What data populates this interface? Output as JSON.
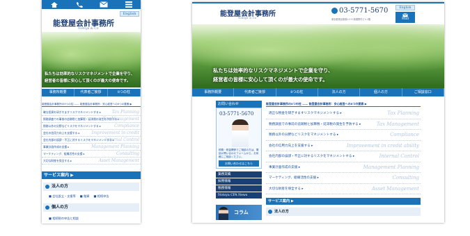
{
  "mobile": {
    "icons": [
      "home-icon",
      "phone-icon",
      "mail-icon",
      "menu-icon"
    ],
    "english_label": "English",
    "title": "能登屋会計事務所",
    "subtitle": "Notoya & Co",
    "hero_caption_1": "私たちは効率的なリスクマネジメントで企業を守り、",
    "hero_caption_2": "経営者の皆様に安心して頂くのが最大の使命です。",
    "nav": [
      "事務所概要",
      "代表者ご挨拶",
      "8つの柱"
    ],
    "section_title": "能登屋会計事務所の8つの柱 —— 能登屋会計事務所：安心経営への8つの要素 ▶",
    "items": [
      {
        "text": "確な投資を研ぎすますリスクマネジメントする ▸",
        "ghost": "Tax Planning"
      },
      {
        "text": "税務調査での事前の追跡税と加算税・延滞税の発生を予防する ▸",
        "ghost": "Tax Management"
      },
      {
        "text": "税務以外の分野などリスクをマネジメントする ▸",
        "ghost": "Compliance"
      },
      {
        "text": "会社の信用力向上を支援する ▸",
        "ghost": "Improvement in credit"
      },
      {
        "text": "会社内部の誤謬・不正に対するリスクをマネジメントする ▸",
        "ghost": "Internal Control"
      },
      {
        "text": "事業計画作成の支援 ▸",
        "ghost": "Management Planning"
      },
      {
        "text": "マーケティング、組織活性の支援 ▸",
        "ghost": "Consulting"
      },
      {
        "text": "大切な財産を保全する ▸",
        "ghost": "Asset Management"
      }
    ],
    "service_header": "サービス案内 ▶",
    "service_1": "法人の方",
    "service_1_links": [
      "■ 会社設立・支援等",
      "■ 融資",
      "■ 相続申告"
    ],
    "service_2": "個人の方",
    "service_2_link": "■ 相続税の申告と相談"
  },
  "desktop": {
    "title": "能登屋会計事務所",
    "subtitle": "Notoya & Co",
    "phone": "03-5771-5670",
    "address": "東京都港区新橋2-5-8 新橋野村ビル2階",
    "english_label": "English",
    "mail_label": "Mail",
    "hero_caption_1": "私たちは効率的なリスクマネジメントで企業を守り、",
    "hero_caption_2": "経営者の皆様に安心して頂くのが最大の使命です。",
    "nav": [
      "事務所概要",
      "代表者ご挨拶",
      "8つの柱",
      "法人の方",
      "個人の方",
      "ご相談窓口"
    ],
    "contact_header": "お問い合わせ",
    "contact_phone": "03-5771-5670",
    "contact_note": "税務・税金関係でご相談の方は、電話か問い合わせフォームから、お気軽にご相談ください。",
    "contact_button": "お問い合わせはこちら",
    "side_links": [
      "業務実績",
      "採用情報",
      "税務情報",
      "Notoya CPA News"
    ],
    "column_label": "コラム",
    "section_title": "能登屋会計事務所の8つの柱 —— 能登屋会計事務所：安心経営への8つの要素 ▶",
    "items": [
      {
        "text": "適正な税金を研ぎすますリスクマネジメントする ▸",
        "ghost": "Tax Planning"
      },
      {
        "text": "税務調査での事前の追跡税と加算税・延滞税の発生を予防する ▸",
        "ghost": "Tax Management"
      },
      {
        "text": "税務以外の分野などリスクをマネジメントする ▸",
        "ghost": "Compliance"
      },
      {
        "text": "会社の信用力向上を支援する ▸",
        "ghost": "Improvement in credit ability"
      },
      {
        "text": "会社内部の誤謬・不正に対するリスクをマネジメントする ▸",
        "ghost": "Internal Control"
      },
      {
        "text": "事業計画作成の支援 ▸",
        "ghost": "Management Planning"
      },
      {
        "text": "マーケティング、組織活性の支援 ▸",
        "ghost": "Consulting"
      },
      {
        "text": "大切な財産を保全する ▸",
        "ghost": "Asset Management"
      }
    ],
    "service_header": "サービス案内 ▶",
    "service_1": "法人の方"
  }
}
